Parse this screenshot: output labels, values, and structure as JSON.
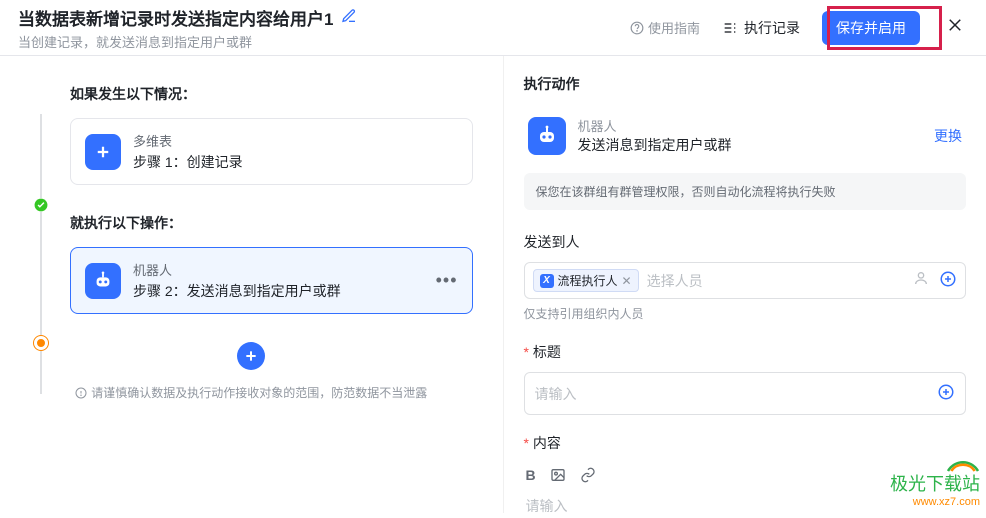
{
  "header": {
    "title": "当数据表新增记录时发送指定内容给用户1",
    "subtitle": "当创建记录，就发送消息到指定用户或群",
    "guide": "使用指南",
    "exec_log": "执行记录",
    "save_btn": "保存并启用"
  },
  "left": {
    "if_label": "如果发生以下情况：",
    "step1": {
      "name": "多维表",
      "desc": "步骤 1：创建记录"
    },
    "then_label": "就执行以下操作：",
    "step2": {
      "name": "机器人",
      "desc": "步骤 2：发送消息到指定用户或群"
    },
    "tip": "请谨慎确认数据及执行动作接收对象的范围，防范数据不当泄露"
  },
  "right": {
    "section": "执行动作",
    "action": {
      "sub": "机器人",
      "title": "发送消息到指定用户或群",
      "swap": "更换"
    },
    "perm_note": "保您在该群组有群管理权限，否则自动化流程将执行失败",
    "send_to_label": "发送到人",
    "chip": "流程执行人",
    "chip_placeholder": "选择人员",
    "hint": "仅支持引用组织内人员",
    "title_label": "标题",
    "title_placeholder": "请输入",
    "content_label": "内容",
    "editor_placeholder": "请输入"
  },
  "watermark": {
    "brand": "极光下载站",
    "url": "www.xz7.com"
  }
}
